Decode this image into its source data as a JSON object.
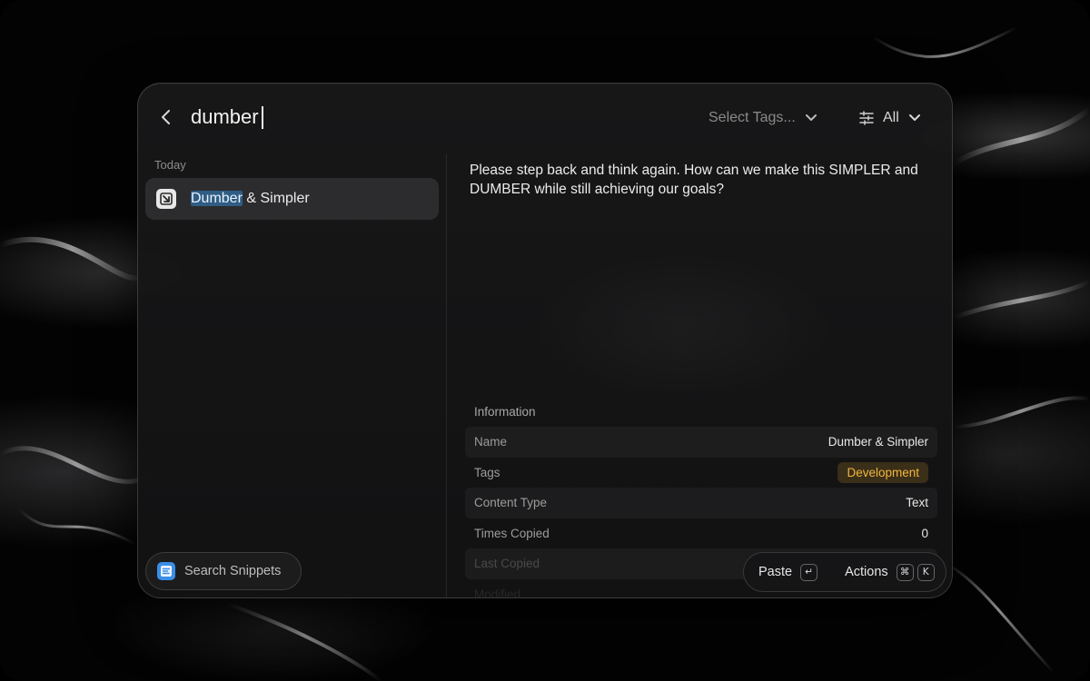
{
  "header": {
    "search_value": "dumber",
    "tags_placeholder": "Select Tags...",
    "filter_label": "All"
  },
  "list": {
    "section_label": "Today",
    "items": [
      {
        "title_match": "Dumber",
        "title_rest": " & Simpler",
        "icon": "snippet-arrow-icon"
      }
    ]
  },
  "preview": {
    "text": "Please step back and think again. How can we make this SIMPLER and DUMBER while still achieving our goals?"
  },
  "information": {
    "heading": "Information",
    "rows": [
      {
        "key": "Name",
        "value": "Dumber & Simpler"
      },
      {
        "key": "Tags",
        "value": "Development"
      },
      {
        "key": "Content Type",
        "value": "Text"
      },
      {
        "key": "Times Copied",
        "value": "0"
      },
      {
        "key": "Last Copied",
        "value": ""
      },
      {
        "key": "Modified",
        "value": ""
      }
    ],
    "tag_color": "#f2b640"
  },
  "footer": {
    "search_snippets_label": "Search Snippets",
    "paste_label": "Paste",
    "paste_key": "↵",
    "actions_label": "Actions",
    "actions_keys": [
      "⌘",
      "K"
    ]
  }
}
